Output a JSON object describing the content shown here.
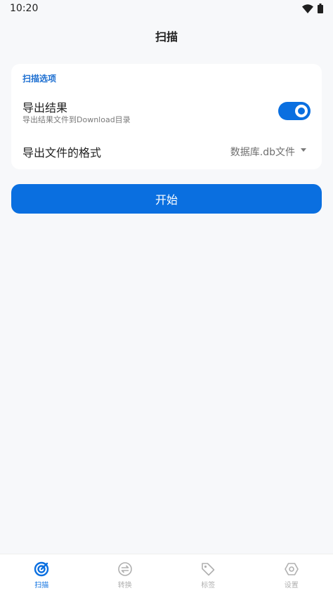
{
  "status_bar": {
    "time": "10:20"
  },
  "app_bar": {
    "title": "扫描"
  },
  "scan_options": {
    "section_label": "扫描选项",
    "export_results": {
      "title": "导出结果",
      "subtitle": "导出结果文件到Download目录",
      "enabled": true
    },
    "export_format": {
      "title": "导出文件的格式",
      "selected_value": "数据库.db文件"
    }
  },
  "start_button": {
    "label": "开始"
  },
  "bottom_nav": {
    "items": [
      {
        "label": "扫描",
        "icon": "scan-icon",
        "active": true
      },
      {
        "label": "转换",
        "icon": "convert-icon",
        "active": false
      },
      {
        "label": "标签",
        "icon": "tag-icon",
        "active": false
      },
      {
        "label": "设置",
        "icon": "settings-icon",
        "active": false
      }
    ]
  },
  "colors": {
    "accent": "#0a6fe0",
    "section_label": "#1d6fd1",
    "background": "#f7f8fa",
    "card": "#ffffff",
    "inactive_nav": "#b0b0b0"
  }
}
